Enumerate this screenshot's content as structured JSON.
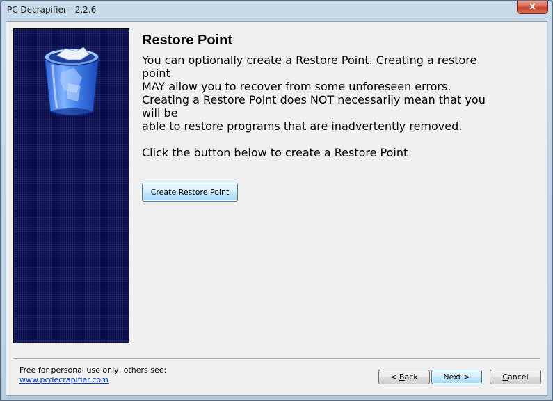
{
  "window": {
    "title": "PC Decrapifier - 2.2.6",
    "close_glyph": "x"
  },
  "content": {
    "heading": "Restore Point",
    "para1_line1": "You can optionally create a Restore Point.  Creating a restore point",
    "para1_line2": "MAY allow you to recover from some unforeseen errors.",
    "para2_line1": "Creating a Restore Point does NOT necessarily mean that you will be",
    "para2_line2": "able to restore programs that are inadvertently removed.",
    "para3": "Click the button below to create a Restore Point",
    "create_button": "Create Restore Point"
  },
  "footer": {
    "note": "Free for personal use only, others see:",
    "link": "www.pcdecrapifier.com",
    "back_prefix": "< ",
    "back_mnemonic": "B",
    "back_rest": "ack",
    "next_label": "Next >",
    "cancel_mnemonic": "C",
    "cancel_rest": "ancel"
  },
  "icons": {
    "side_panel": "recycle-bin-icon",
    "close": "close-icon"
  },
  "colors": {
    "side_panel_bg": "#0a0f4f",
    "link": "#0033cc",
    "close_button": "#c3402a"
  }
}
